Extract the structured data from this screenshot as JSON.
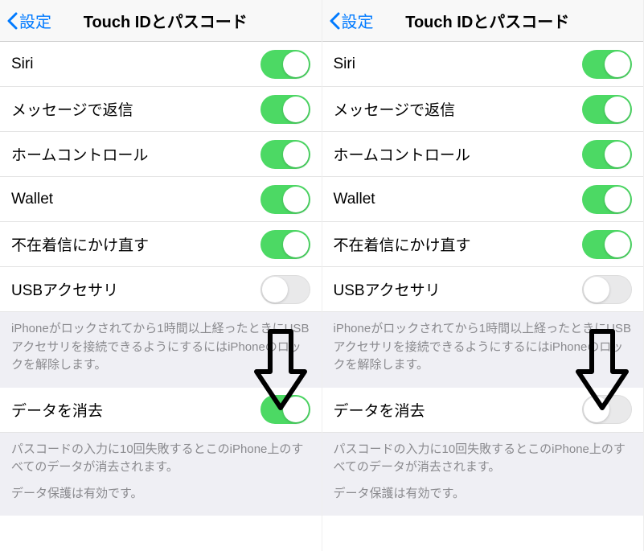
{
  "header": {
    "back_label": "設定",
    "title": "Touch IDとパスコード"
  },
  "rows": {
    "siri": "Siri",
    "reply_message": "メッセージで返信",
    "home_control": "ホームコントロール",
    "wallet": "Wallet",
    "return_missed": "不在着信にかけ直す",
    "usb_accessory": "USBアクセサリ",
    "erase_data": "データを消去"
  },
  "footers": {
    "usb": "iPhoneがロックされてから1時間以上経ったときにUSBアクセサリを接続できるようにするにはiPhoneのロックを解除します。",
    "erase1": "パスコードの入力に10回失敗するとこのiPhone上のすべてのデータが消去されます。",
    "erase2": "データ保護は有効です。"
  },
  "panels": {
    "left": {
      "toggles": {
        "siri": true,
        "reply_message": true,
        "home_control": true,
        "wallet": true,
        "return_missed": true,
        "usb_accessory": false,
        "erase_data": true
      }
    },
    "right": {
      "toggles": {
        "siri": true,
        "reply_message": true,
        "home_control": true,
        "wallet": true,
        "return_missed": true,
        "usb_accessory": false,
        "erase_data": false
      }
    }
  }
}
